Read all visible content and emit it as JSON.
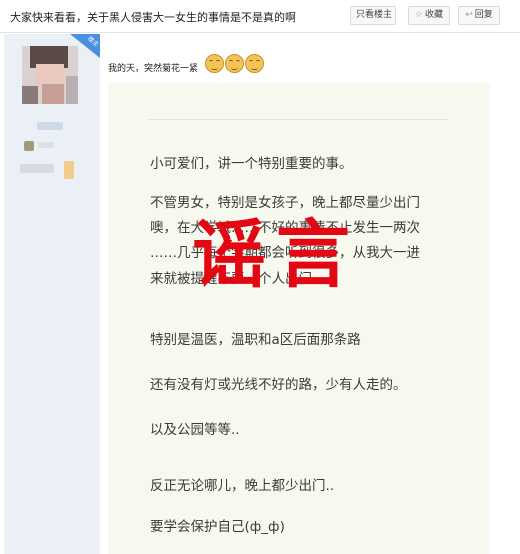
{
  "header": {
    "title": "大家快来看看，关于黑人侵害大一女生的事情是不是真的啊",
    "buttons": [
      {
        "label": "只看楼主",
        "icon": "user-icon"
      },
      {
        "label": "收藏",
        "icon": "star-icon"
      },
      {
        "label": "回复",
        "icon": "reply-icon"
      }
    ]
  },
  "post": {
    "op_text": "我的天，突然菊花一紧",
    "emoji_icon": "grin-emoji-icon",
    "paragraphs": [
      "小可爱们，讲一个特别重要的事。",
      "不管男女，特别是女孩子，晚上都尽量少出门",
      "噢，在大学城……不好的事情不止发生一两次",
      "……几乎每个学期都会听到很多，从我大一进",
      "来就被提醒不要一个人出门。",
      "特别是温医，温职和a区后面那条路",
      "还有没有灯或光线不好的路，少有人走的。",
      "以及公园等等..",
      "反正无论哪儿，晚上都少出门..",
      "要学会保护自己(ф_ф)"
    ],
    "stamp_text": "谣言"
  },
  "colors": {
    "stamp": "#e30613",
    "card_bg": "#f8f9ee",
    "sidebar_bg": "#eaf0f6",
    "tag": "#4a8fe0"
  }
}
